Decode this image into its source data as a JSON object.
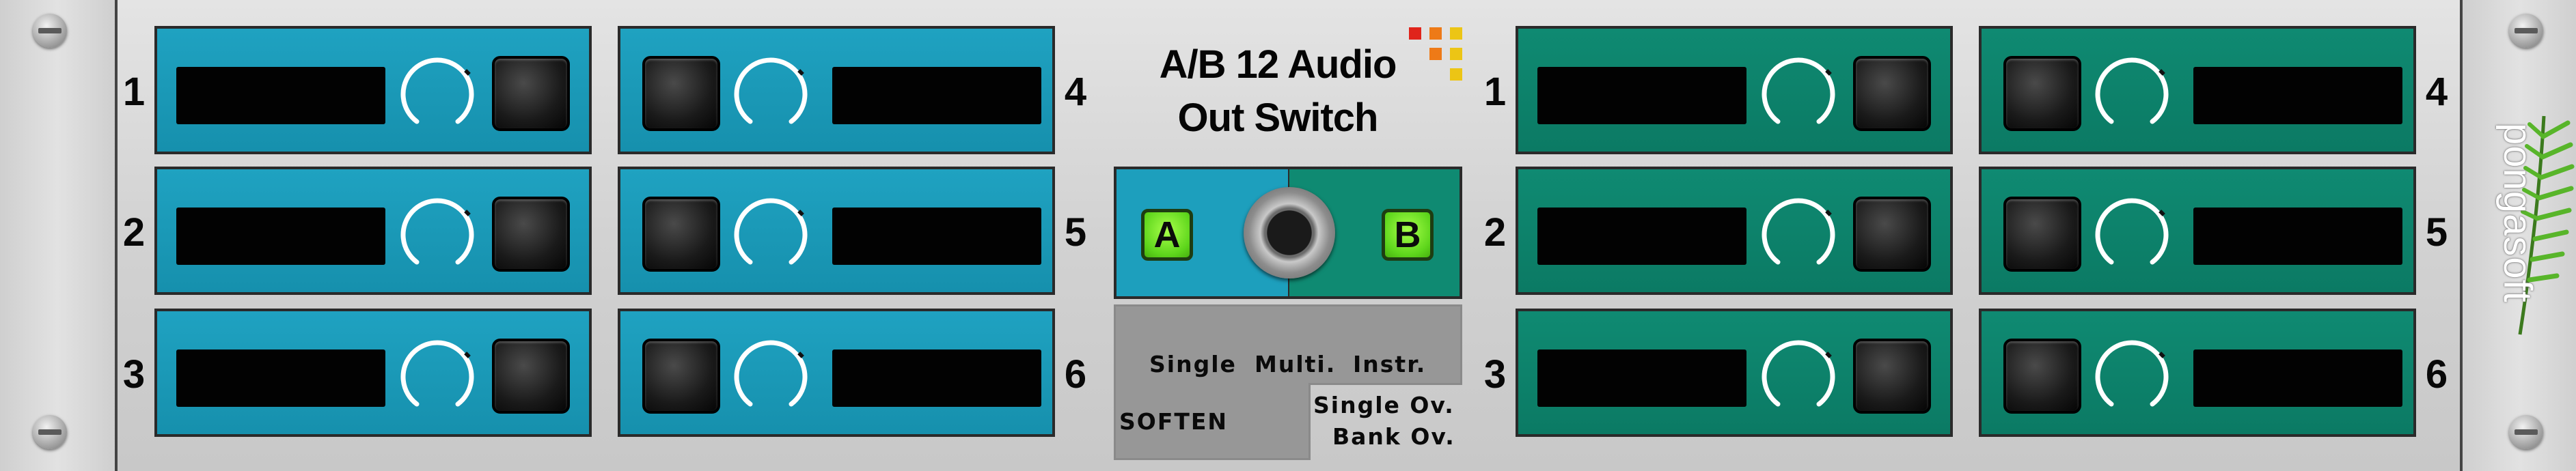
{
  "device": {
    "title_line1": "A/B 12 Audio",
    "title_line2": "Out Switch",
    "brand": "pongasoft"
  },
  "channels_a": {
    "left_column": [
      "1",
      "2",
      "3"
    ],
    "right_column": [
      "4",
      "5",
      "6"
    ]
  },
  "channels_b": {
    "left_column": [
      "1",
      "2",
      "3"
    ],
    "right_column": [
      "4",
      "5",
      "6"
    ]
  },
  "ab_switch": {
    "a_label": "A",
    "b_label": "B",
    "selected": "A"
  },
  "soften": {
    "title": "SOFTEN",
    "options": [
      "Single",
      "Multi.",
      "Instr."
    ],
    "overrides": [
      "Single Ov.",
      "Bank Ov."
    ]
  },
  "colors": {
    "side_a": "#1d9fbd",
    "side_b": "#0f8a72",
    "led_on": "#6edc24",
    "panel_bg": "#d6d6d6"
  },
  "icons": [
    "screw-icon",
    "knob-icon",
    "push-button-icon",
    "led-grid-logo-icon",
    "palm-leaf-logo-icon"
  ]
}
